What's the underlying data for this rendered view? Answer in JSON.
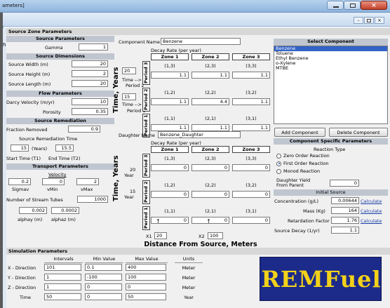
{
  "window": {
    "title": "ameters]"
  },
  "source": {
    "section_title": "Source Zone Parameters",
    "source_params": "Source Parameters",
    "gamma_label": "Gamma",
    "gamma": "1",
    "dims": "Source Dimensions",
    "width_label": "Source Width (m)",
    "width": "20",
    "height_label": "Source Height (m)",
    "height": "2",
    "length_label": "Source Length (m)",
    "length": "20",
    "flow": "Flow Parameters",
    "darcy_label": "Darcy Velocity (m/yr)",
    "darcy": "10",
    "porosity_label": "Porosity",
    "porosity": "0.35",
    "remed": "Source Remediation",
    "fraction_label": "Fraction Removed",
    "fraction": "0.9",
    "rem_time_label": "Source Remediation Time",
    "t1": "15",
    "years": "(Years)",
    "t2": "15.5",
    "start_label": "Start Time (T1)",
    "end_label": "End Time (T2)",
    "transport": "Transport Parameters",
    "velocity": "Velocity",
    "sigmav": "0.2",
    "vmin": "0",
    "vmax": "2",
    "sigmav_label": "Sigmav",
    "vmin_label": "vMin",
    "vmax_label": "vMax",
    "tubes_label": "Number of Stream Tubes",
    "tubes": "1000",
    "alphay": "0.002",
    "alphaz": "0.0002",
    "alphay_label": "alphay (m)",
    "alphaz_label": "alphaz (m)"
  },
  "component": {
    "name_label": "Component Name",
    "name": "Benzene",
    "decay_label": "Decay Rate (per year)",
    "zones": [
      "Zone 1",
      "Zone 2",
      "Zone 3"
    ],
    "periods": [
      "Period 3",
      "Period 2",
      "Period 1"
    ],
    "codes": [
      [
        "(1,3)",
        "(2,3)",
        "(3,3)"
      ],
      [
        "(1,2)",
        "(2,2)",
        "(3,2)"
      ],
      [
        "(1,1)",
        "(2,1)",
        "(3,1)"
      ]
    ],
    "values": [
      [
        "1.1",
        "1.1",
        "1.1"
      ],
      [
        "1.1",
        "4.4",
        "1.1"
      ],
      [
        "1.1",
        "1.1",
        "1.1"
      ]
    ],
    "time_axis": "Time, Years",
    "t_top": "20",
    "t_mid": "15",
    "time_arrow": "Time -->",
    "period2": "Period 2",
    "period1": "Period 1"
  },
  "daughter": {
    "name_label": "Daughter Name",
    "name": "Benzene_Daughter",
    "decay_label": "Decay Rate (per year)",
    "zones": [
      "Zone 1",
      "Zone 2",
      "Zone 3"
    ],
    "periods": [
      "Period 3",
      "Period 2",
      "Period 1"
    ],
    "codes": [
      [
        "(1,3)",
        "(2,3)",
        "(3,3)"
      ],
      [
        "(1,2)",
        "(2,2)",
        "(3,2)"
      ],
      [
        "(1,1)",
        "(2,1)",
        "(3,1)"
      ]
    ],
    "values": [
      [
        "0",
        "0",
        "0"
      ],
      [
        "0",
        "0",
        "0"
      ],
      [
        "0",
        "0",
        "0"
      ]
    ],
    "time_axis": "Time, Years",
    "t_top": "20",
    "t_mid": "15",
    "year": "Year",
    "x1_label": "X1",
    "x1": "20",
    "x2_label": "X2",
    "x2": "100",
    "distance": "Distance From Source, Meters"
  },
  "select": {
    "title": "Select Component",
    "items": [
      "Benzene",
      "Toluene",
      "Ethyl Benzene",
      "o-Xylene",
      "MTBE"
    ],
    "add": "Add Component",
    "delete": "Delete Component",
    "specific": "Component Specific Parameters",
    "reaction_type": "Reaction Type",
    "zero": "Zero Order Reaction",
    "first": "First Order Reaction",
    "monod": "Monod Reaction",
    "yield_label": "Daughter Yield From Parent",
    "yield": "0",
    "initial": "Initial Source",
    "conc_label": "Concentration (g/L)",
    "conc": "0.00644",
    "mass_label": "Mass (Kg)",
    "mass": "164",
    "retard_label": "Retardation Factor",
    "retard": "1.76",
    "sdecay_label": "Source Decay (1/yr)",
    "sdecay": "1.1",
    "calc": "Calculate"
  },
  "sim": {
    "title": "Simulation Parameters",
    "headers": [
      "Intervals",
      "Min Value",
      "Max Value",
      "Units"
    ],
    "rows": [
      {
        "label": "X - Direction",
        "a": "101",
        "b": "0.1",
        "c": "400",
        "u": "Meter"
      },
      {
        "label": "Y - Direction",
        "a": "1",
        "b": "-100",
        "c": "100",
        "u": "Meter"
      },
      {
        "label": "Z - Direction",
        "a": "1",
        "b": "0",
        "c": "0",
        "u": "Meter"
      },
      {
        "label": "Time",
        "a": "50",
        "b": "0",
        "c": "50",
        "u": "Year"
      }
    ]
  },
  "logo": "REMFuel",
  "colors": {
    "logo_bg": "#1c2a8a",
    "logo_text": "#f2d21a"
  }
}
